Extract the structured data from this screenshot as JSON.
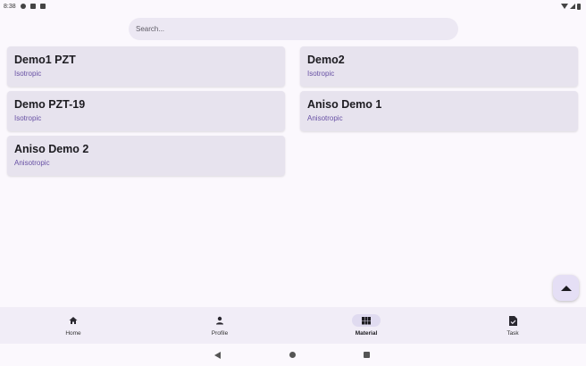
{
  "status_bar": {
    "time": "8:38"
  },
  "search": {
    "placeholder": "Search..."
  },
  "materials": [
    {
      "name": "Demo1 PZT",
      "type": "Isotropic"
    },
    {
      "name": "Demo2",
      "type": "Isotropic"
    },
    {
      "name": "Demo PZT-19",
      "type": "Isotropic"
    },
    {
      "name": "Aniso Demo 1",
      "type": "Anisotropic"
    },
    {
      "name": "Aniso Demo 2",
      "type": "Anisotropic"
    }
  ],
  "fab": {
    "icon": "arrow-up-icon"
  },
  "bottom_nav": {
    "items": [
      {
        "label": "Home",
        "icon": "home-icon"
      },
      {
        "label": "Profile",
        "icon": "person-icon"
      },
      {
        "label": "Material",
        "icon": "grid-icon",
        "active": true
      },
      {
        "label": "Task",
        "icon": "task-icon"
      }
    ]
  },
  "colors": {
    "accent": "#6750a4",
    "card": "#e7e3ee",
    "background": "#fbf8fd"
  }
}
